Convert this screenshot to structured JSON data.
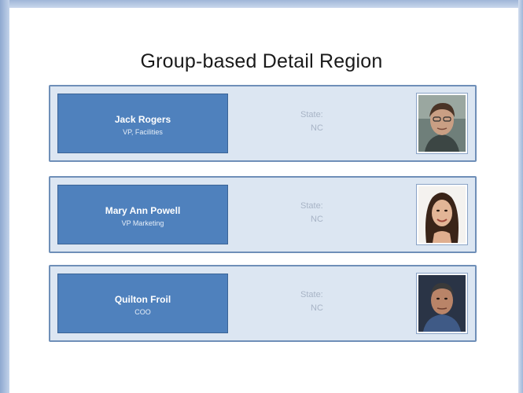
{
  "title": "Group-based Detail Region",
  "cards": [
    {
      "name": "Jack Rogers",
      "role": "VP, Facilities",
      "state_label": "State:",
      "state_value": "NC"
    },
    {
      "name": "Mary Ann Powell",
      "role": "VP Marketing",
      "state_label": "State:",
      "state_value": "NC"
    },
    {
      "name": "Quilton Froil",
      "role": "COO",
      "state_label": "State:",
      "state_value": "NC"
    }
  ]
}
